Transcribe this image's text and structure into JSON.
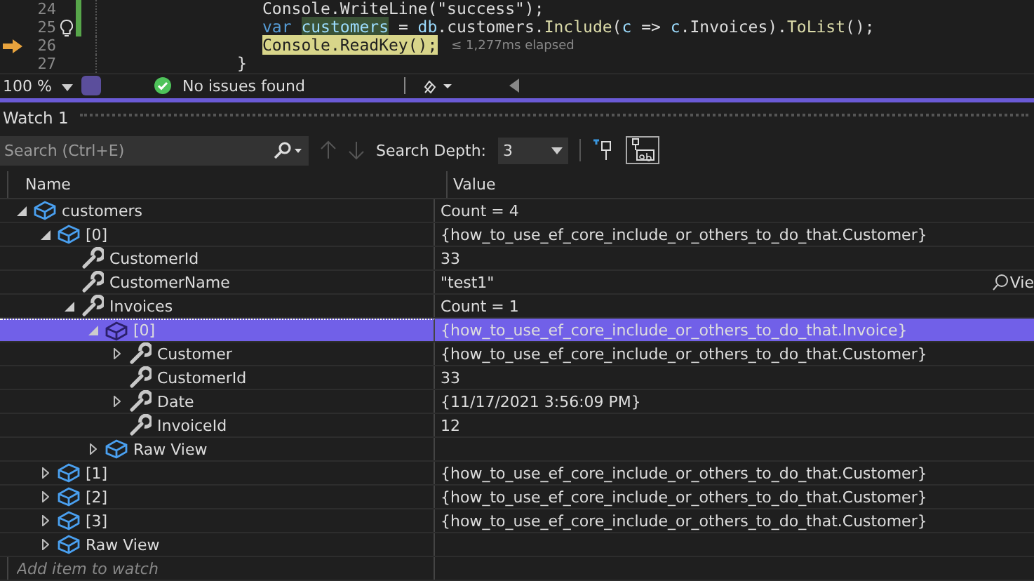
{
  "editor": {
    "lines": [
      {
        "number": "24",
        "changed": true,
        "lightbulb": false,
        "current": false,
        "tokens": [
          {
            "text": "Console.WriteLine(\"success\");",
            "kind": "plain"
          }
        ]
      },
      {
        "number": "25",
        "changed": true,
        "lightbulb": true,
        "current": false,
        "tokens": [
          {
            "text": "var ",
            "kind": "keyword"
          },
          {
            "text": "customers",
            "kind": "highlight"
          },
          {
            "text": " = ",
            "kind": "plain"
          },
          {
            "text": "db",
            "kind": "variable"
          },
          {
            "text": ".customers.",
            "kind": "plain"
          },
          {
            "text": "Include",
            "kind": "method"
          },
          {
            "text": "(",
            "kind": "plain"
          },
          {
            "text": "c",
            "kind": "variable"
          },
          {
            "text": " => ",
            "kind": "plain"
          },
          {
            "text": "c",
            "kind": "variable"
          },
          {
            "text": ".Invoices).",
            "kind": "plain"
          },
          {
            "text": "ToList",
            "kind": "method"
          },
          {
            "text": "();",
            "kind": "plain"
          }
        ]
      },
      {
        "number": "26",
        "changed": false,
        "lightbulb": false,
        "current": true,
        "hint": "≤ 1,277ms elapsed",
        "tokens": [
          {
            "text": "Console.ReadKey();",
            "kind": "current"
          }
        ]
      },
      {
        "number": "27",
        "changed": false,
        "lightbulb": false,
        "current": false,
        "tokens": [
          {
            "text": "}",
            "kind": "brace"
          }
        ]
      }
    ]
  },
  "status_bar": {
    "zoom": "100 %",
    "issues": "No issues found"
  },
  "watch": {
    "title": "Watch 1",
    "search": {
      "placeholder": "Search (Ctrl+E)"
    },
    "depth_label": "Search Depth:",
    "depth": "3",
    "columns": [
      "Name",
      "Value"
    ],
    "rows": [
      {
        "name": "customers",
        "kind": "object",
        "value": "Count = 4",
        "expanded": true,
        "selected": false,
        "children": [
          {
            "name": "[0]",
            "kind": "object",
            "value": "{how_to_use_ef_core_include_or_others_to_do_that.Customer}",
            "expanded": true,
            "selected": false,
            "children": [
              {
                "name": "CustomerId",
                "kind": "property",
                "value": "33",
                "selected": false
              },
              {
                "name": "CustomerName",
                "kind": "property",
                "value": "\"test1\"",
                "visualizer": "Vie",
                "selected": false
              },
              {
                "name": "Invoices",
                "kind": "property",
                "value": "Count = 1",
                "expanded": true,
                "selected": false,
                "children": [
                  {
                    "name": "[0]",
                    "kind": "object",
                    "value": "{how_to_use_ef_core_include_or_others_to_do_that.Invoice}",
                    "expanded": true,
                    "selected": true,
                    "children": [
                      {
                        "name": "Customer",
                        "kind": "property",
                        "value": "{how_to_use_ef_core_include_or_others_to_do_that.Customer}",
                        "expanded": false,
                        "selected": false
                      },
                      {
                        "name": "CustomerId",
                        "kind": "property",
                        "value": "33",
                        "selected": false
                      },
                      {
                        "name": "Date",
                        "kind": "property",
                        "value": "{11/17/2021 3:56:09 PM}",
                        "expanded": false,
                        "selected": false
                      },
                      {
                        "name": "InvoiceId",
                        "kind": "property",
                        "value": "12",
                        "selected": false
                      }
                    ]
                  },
                  {
                    "name": "Raw View",
                    "kind": "object",
                    "expanded": false,
                    "selected": false
                  }
                ]
              }
            ]
          },
          {
            "name": "[1]",
            "kind": "object",
            "value": "{how_to_use_ef_core_include_or_others_to_do_that.Customer}",
            "expanded": false,
            "selected": false
          },
          {
            "name": "[2]",
            "kind": "object",
            "value": "{how_to_use_ef_core_include_or_others_to_do_that.Customer}",
            "expanded": false,
            "selected": false
          },
          {
            "name": "[3]",
            "kind": "object",
            "value": "{how_to_use_ef_core_include_or_others_to_do_that.Customer}",
            "expanded": false,
            "selected": false
          },
          {
            "name": "Raw View",
            "kind": "object",
            "expanded": false,
            "selected": false
          }
        ]
      }
    ],
    "add_placeholder": "Add item to watch"
  }
}
